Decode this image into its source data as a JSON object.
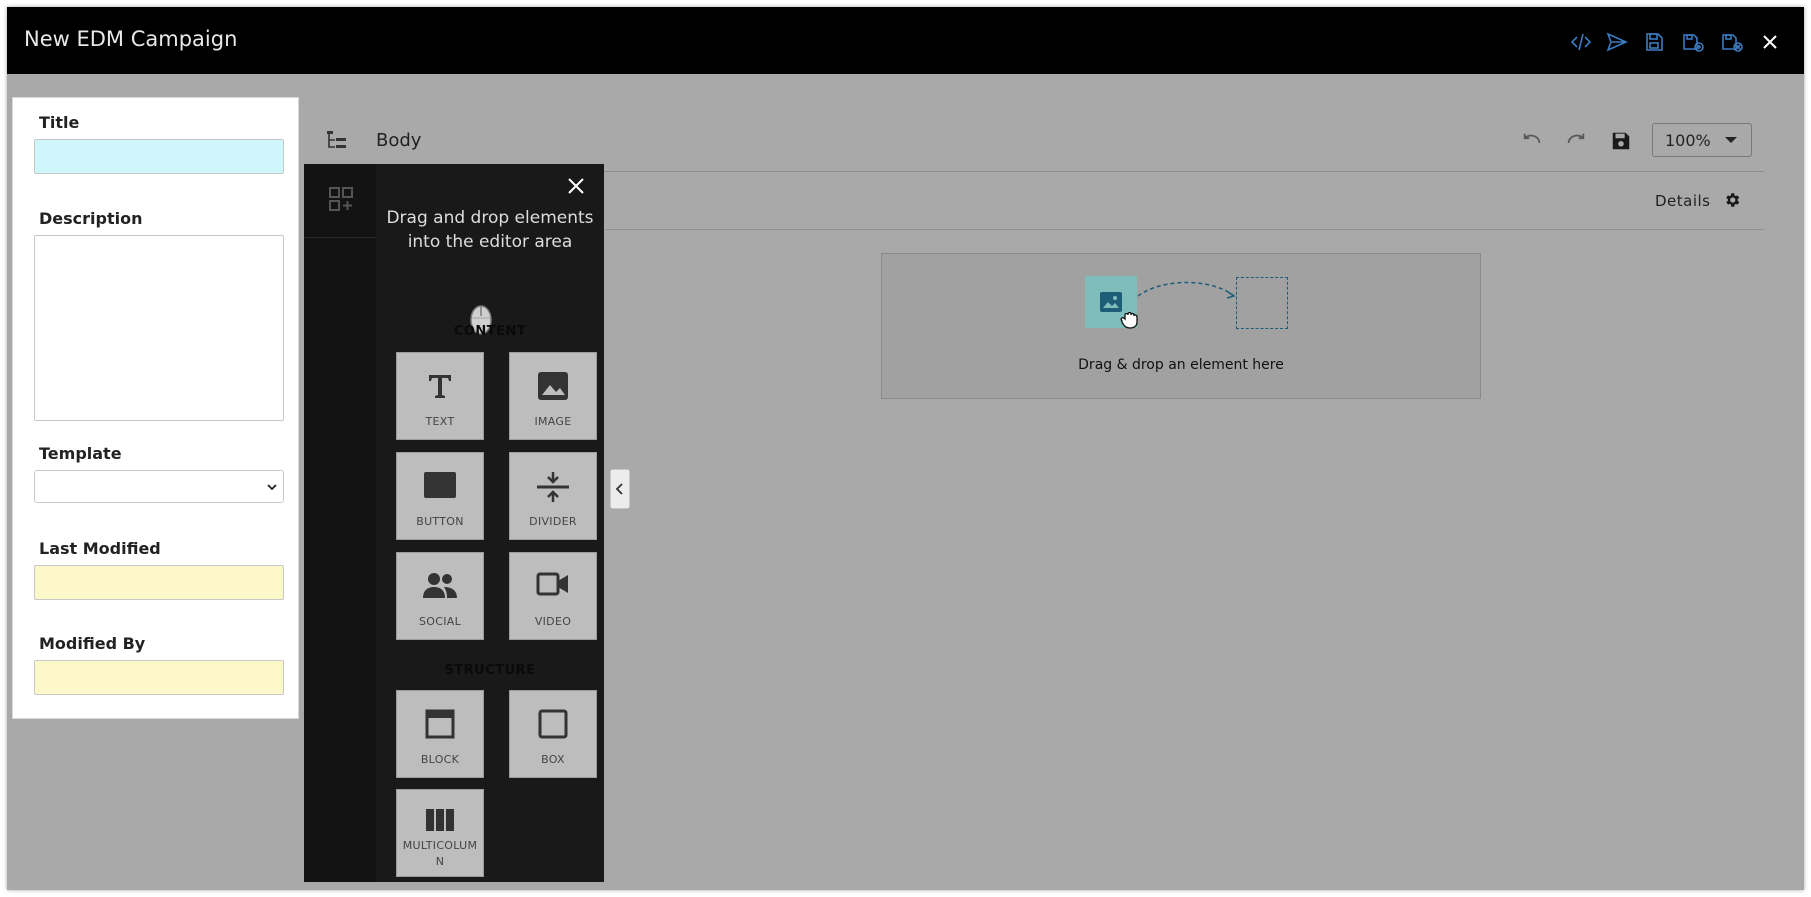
{
  "window": {
    "title": "New EDM Campaign",
    "toolbar_icons": [
      "code-icon",
      "send-icon",
      "save-icon",
      "save-as-icon",
      "save-and-close-icon",
      "close-icon"
    ],
    "accent_color": "#3b7bbf"
  },
  "form": {
    "title_label": "Title",
    "title_value": "",
    "description_label": "Description",
    "description_value": "",
    "template_label": "Template",
    "template_value": "",
    "last_modified_label": "Last Modified",
    "last_modified_value": "",
    "modified_by_label": "Modified By",
    "modified_by_value": ""
  },
  "editor": {
    "breadcrumb": "Body",
    "zoom": "100%",
    "details_label": "Details",
    "drop_hint": "Drag & drop an element here"
  },
  "drawer": {
    "intro": "Drag and drop elements into the editor area",
    "content_title": "CONTENT",
    "structure_title": "STRUCTURE",
    "content_items": [
      {
        "label": "TEXT",
        "icon": "text-icon"
      },
      {
        "label": "IMAGE",
        "icon": "image-icon"
      },
      {
        "label": "BUTTON",
        "icon": "button-icon"
      },
      {
        "label": "DIVIDER",
        "icon": "divider-icon"
      },
      {
        "label": "SOCIAL",
        "icon": "social-icon"
      },
      {
        "label": "VIDEO",
        "icon": "video-icon"
      }
    ],
    "structure_items": [
      {
        "label": "BLOCK",
        "icon": "block-icon"
      },
      {
        "label": "BOX",
        "icon": "box-icon"
      },
      {
        "label": "MULTICOLUMN",
        "icon": "multicolumn-icon"
      }
    ]
  }
}
